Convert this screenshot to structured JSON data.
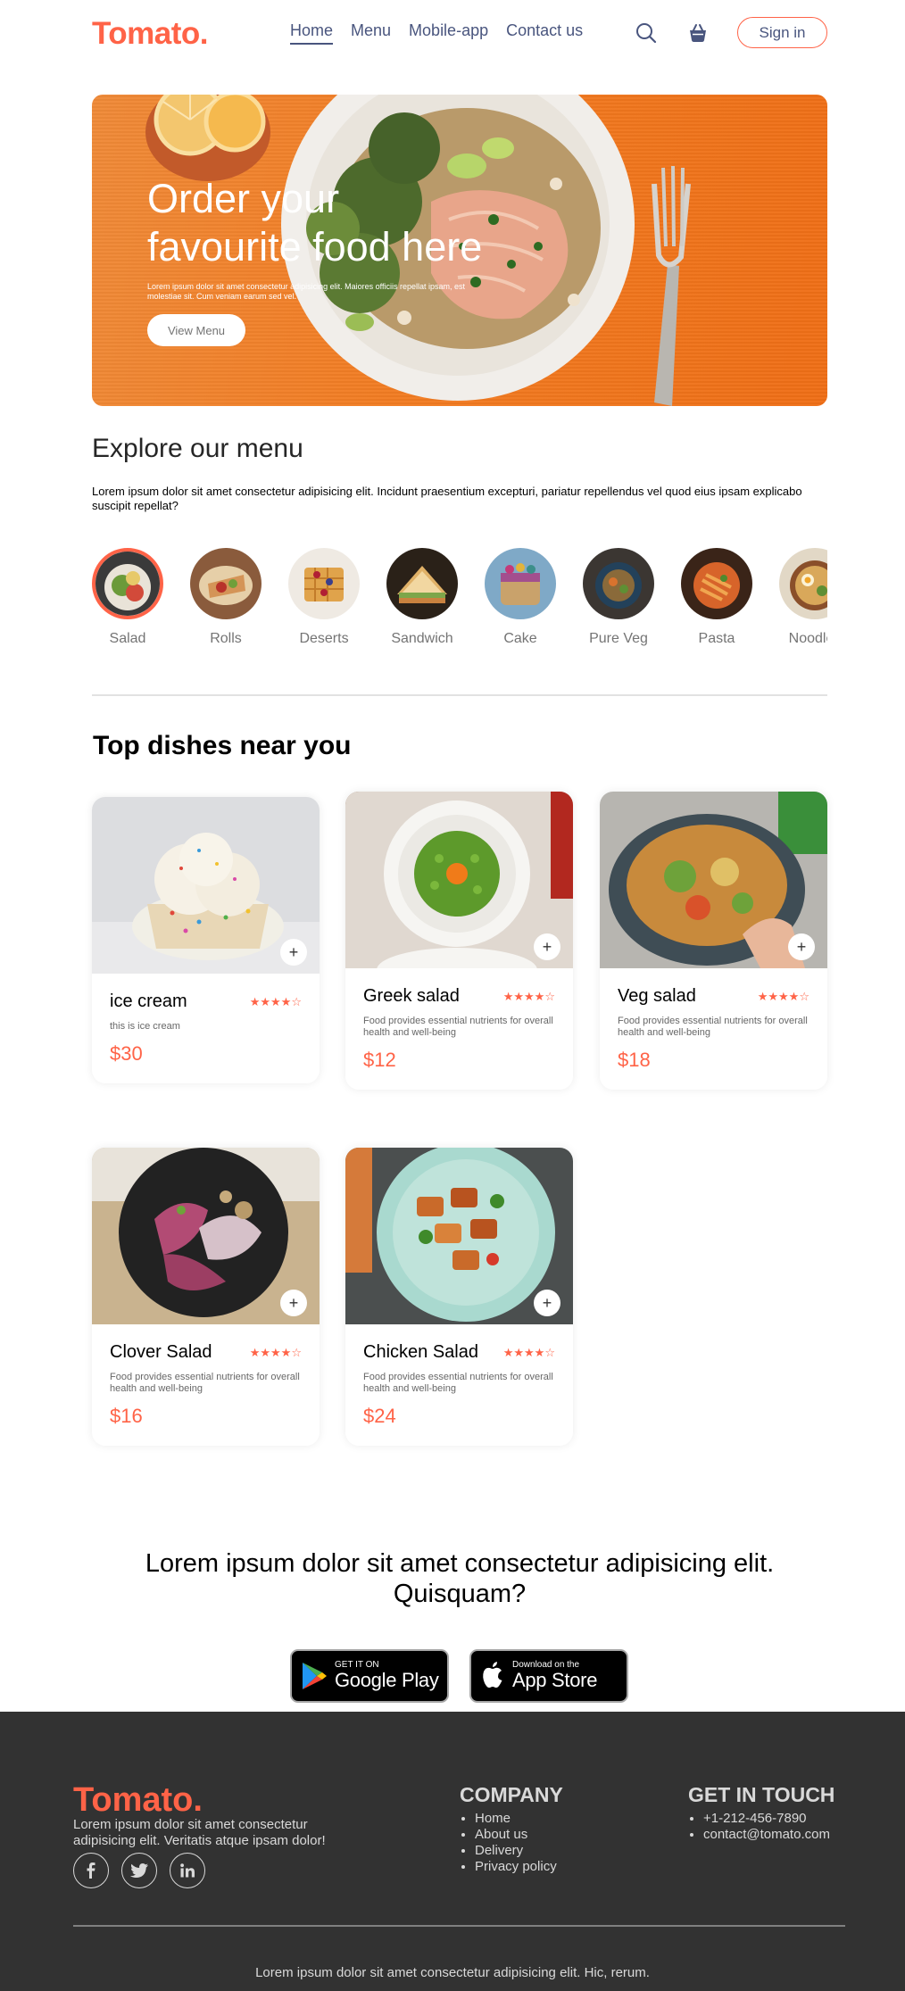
{
  "brand": {
    "logo": "Tomato.",
    "accent": "#ff6347"
  },
  "nav": {
    "items": [
      {
        "label": "Home"
      },
      {
        "label": "Menu"
      },
      {
        "label": "Mobile-app"
      },
      {
        "label": "Contact us"
      }
    ],
    "active": "Home",
    "search_icon": "search-icon",
    "basket_icon": "basket-icon",
    "signin_label": "Sign in"
  },
  "hero": {
    "title": "Order your favourite food here",
    "text": "Lorem ipsum dolor sit amet consectetur adipisicing elit. Maiores officiis repellat ipsam, est molestiae sit. Cum veniam earum sed vel.",
    "button": "View Menu"
  },
  "explore": {
    "title": "Explore our menu",
    "text": "Lorem ipsum dolor sit amet consectetur adipisicing elit. Incidunt praesentium excepturi, pariatur repellendus vel quod eius ipsam explicabo suscipit repellat?",
    "categories": [
      {
        "label": "Salad"
      },
      {
        "label": "Rolls"
      },
      {
        "label": "Deserts"
      },
      {
        "label": "Sandwich"
      },
      {
        "label": "Cake"
      },
      {
        "label": "Pure Veg"
      },
      {
        "label": "Pasta"
      },
      {
        "label": "Noodles"
      }
    ],
    "active": "Salad"
  },
  "dishes": {
    "title": "Top dishes near you",
    "items": [
      {
        "name": "ice cream",
        "rating": "★★★★☆",
        "desc": "this is ice cream",
        "price": "$30"
      },
      {
        "name": "Greek salad",
        "rating": "★★★★☆",
        "desc": "Food provides essential nutrients for overall health and well-being",
        "price": "$12"
      },
      {
        "name": "Veg salad",
        "rating": "★★★★☆",
        "desc": "Food provides essential nutrients for overall health and well-being",
        "price": "$18"
      },
      {
        "name": "Clover Salad",
        "rating": "★★★★☆",
        "desc": "Food provides essential nutrients for overall health and well-being",
        "price": "$16"
      },
      {
        "name": "Chicken Salad",
        "rating": "★★★★☆",
        "desc": "Food provides essential nutrients for overall health and well-being",
        "price": "$24"
      }
    ],
    "add_label": "+"
  },
  "app_download": {
    "title": "Lorem ipsum dolor sit amet consectetur adipisicing elit. Quisquam?",
    "google": {
      "small": "GET IT ON",
      "big": "Google Play"
    },
    "apple": {
      "small": "Download on the",
      "big": "App Store"
    }
  },
  "footer": {
    "logo": "Tomato.",
    "text": "Lorem ipsum dolor sit amet consectetur adipisicing elit. Veritatis atque ipsam dolor!",
    "socials": [
      "facebook-icon",
      "twitter-icon",
      "linkedin-icon"
    ],
    "company": {
      "title": "COMPANY",
      "links": [
        "Home",
        "About us",
        "Delivery",
        "Privacy policy"
      ]
    },
    "contact": {
      "title": "GET IN TOUCH",
      "items": [
        "+1-212-456-7890",
        "contact@tomato.com"
      ]
    },
    "copyright": "Lorem ipsum dolor sit amet consectetur adipisicing elit. Hic, rerum."
  }
}
